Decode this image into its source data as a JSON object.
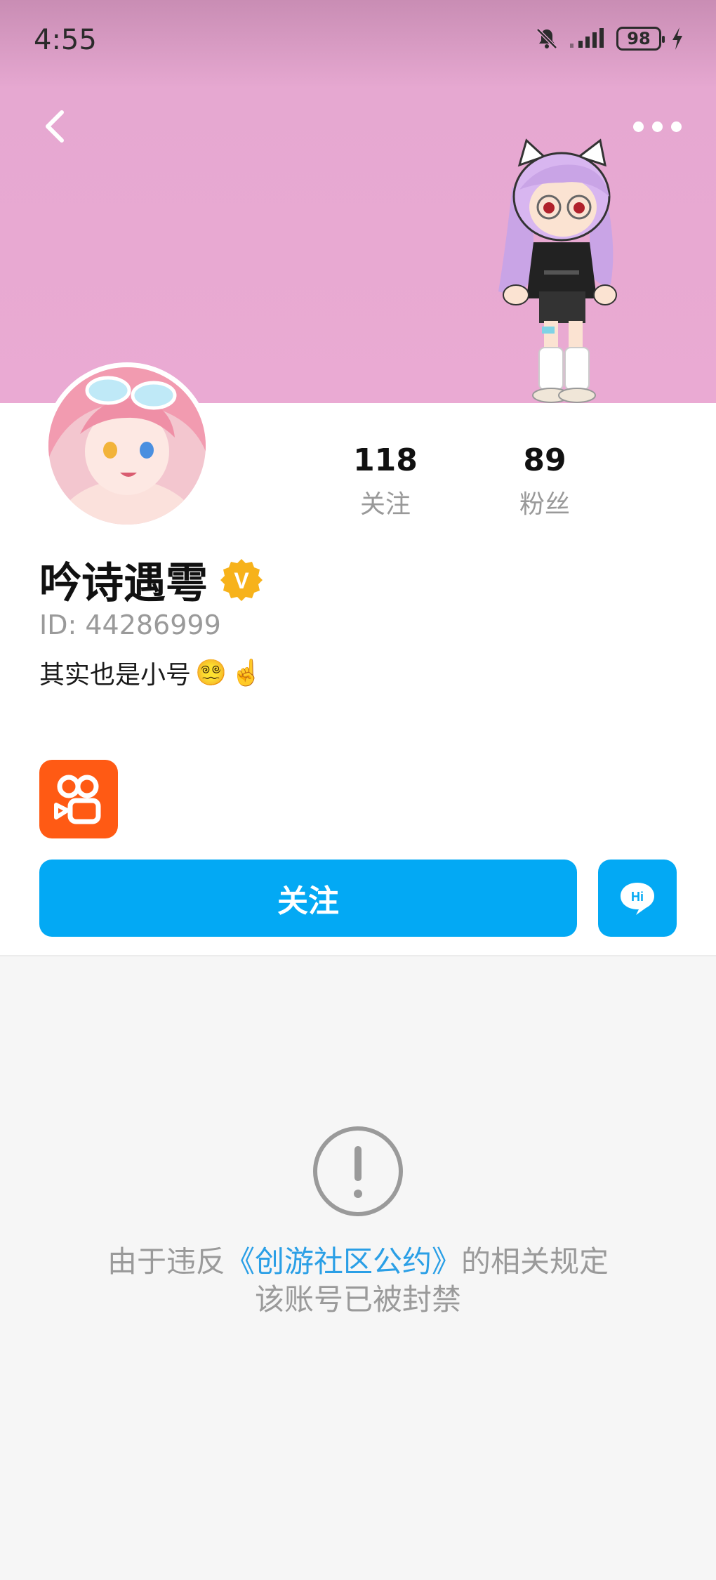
{
  "status_bar": {
    "time": "4:55",
    "battery": "98"
  },
  "header": {
    "back_icon": "chevron-left-icon",
    "more_icon": "more-dots-icon"
  },
  "profile": {
    "name": "吟诗遇雩",
    "badge": "V",
    "id_text": "ID: 44286999",
    "bio": "其实也是小号",
    "bio_emojis": [
      "😵‍💫",
      "☝️"
    ],
    "stats": [
      {
        "value": "118",
        "label": "关注"
      },
      {
        "value": "89",
        "label": "粉丝"
      }
    ]
  },
  "actions": {
    "follow_label": "关注",
    "message_label": "Hi"
  },
  "notice": {
    "prefix": "由于违反",
    "link": "《创游社区公约》",
    "suffix": "的相关规定",
    "line2": "该账号已被封禁"
  },
  "colors": {
    "accent": "#03a9f4",
    "banner": "#eaaad3",
    "badge": "#f7b21a",
    "app_logo": "#ff5a14",
    "link": "#2a9fe6"
  }
}
